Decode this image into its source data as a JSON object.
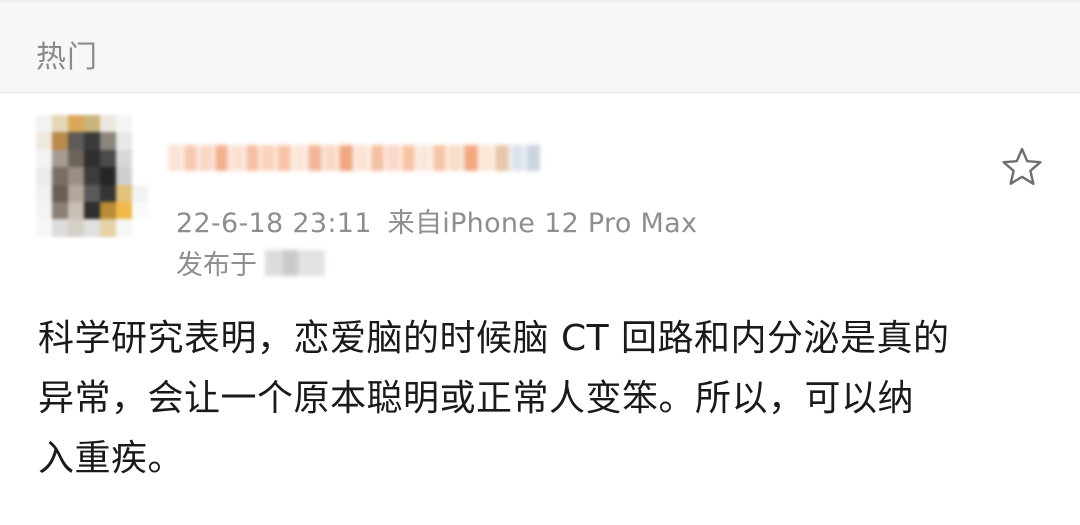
{
  "header": {
    "section_title": "热门"
  },
  "post": {
    "avatar_icon": "avatar-pixelated",
    "username": "",
    "timestamp": "22-6-18 23:11",
    "source": "来自iPhone 12 Pro Max",
    "location_label": "发布于",
    "favorite_icon": "star-outline-icon",
    "content_lines": [
      "科学研究表明，恋爱脑的时候脑 CT 回路和内分泌是真的",
      "异常，会让一个原本聪明或正常人变笨。所以，可以纳",
      "入重疾。"
    ]
  },
  "colors": {
    "header_bg": "#f7f7f7",
    "meta_text": "#8e8e8e",
    "body_text": "#1a1a1a"
  }
}
